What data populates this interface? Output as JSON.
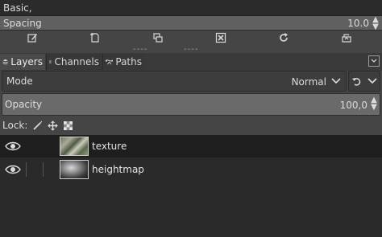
{
  "brush": {
    "preset_value": "Basic,",
    "spacing_label": "Spacing",
    "spacing_value": "10.0",
    "spin_up": "▲",
    "spin_down": "▼"
  },
  "brush_tools": [
    {
      "name": "edit-brush",
      "icon": "edit-icon"
    },
    {
      "name": "new-brush",
      "icon": "new-document-icon"
    },
    {
      "name": "duplicate-brush",
      "icon": "duplicate-icon"
    },
    {
      "name": "delete-brush",
      "icon": "delete-icon"
    },
    {
      "name": "refresh-brushes",
      "icon": "refresh-icon"
    },
    {
      "name": "open-brush-as-image",
      "icon": "open-image-icon"
    }
  ],
  "grip": "----",
  "tabs": [
    {
      "label": "Layers",
      "icon": "layers-icon",
      "active": true
    },
    {
      "label": "Channels",
      "icon": "channels-icon",
      "active": false
    },
    {
      "label": "Paths",
      "icon": "paths-icon",
      "active": false
    }
  ],
  "mode": {
    "label": "Mode",
    "value": "Normal"
  },
  "opacity": {
    "label": "Opacity",
    "value": "100,0"
  },
  "lock": {
    "label": "Lock:"
  },
  "layers": [
    {
      "name": "texture",
      "visible": true,
      "selected": true
    },
    {
      "name": "heightmap",
      "visible": true,
      "selected": false
    }
  ],
  "colors": {
    "panel_bg": "#454545",
    "list_bg": "#2a2a2a",
    "selected_row": "#1e1e1e",
    "slider_fill": "#6a6a6a"
  }
}
